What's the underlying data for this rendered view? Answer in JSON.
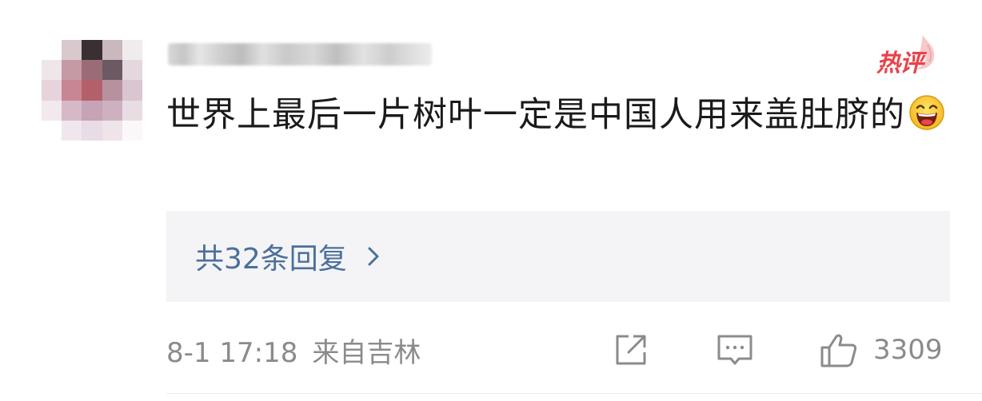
{
  "comment": {
    "username": "",
    "badge": "热评",
    "text": "世界上最后一片树叶一定是中国人用来盖肚脐的",
    "emoji_icon": "laughing-face-icon",
    "replies_label": "共32条回复",
    "replies_chevron_icon": "chevron-right-icon",
    "timestamp": "8-1 17:18",
    "location": "来自吉林",
    "share_icon": "share-icon",
    "reply_icon": "comment-icon",
    "like_icon": "thumbs-up-icon",
    "like_count": "3309"
  },
  "colors": {
    "badge": "#e8434a",
    "link": "#4b6f9c",
    "meta": "#8b8b8b",
    "reply_box_bg": "#f4f4f6",
    "text": "#1a1a1a"
  }
}
